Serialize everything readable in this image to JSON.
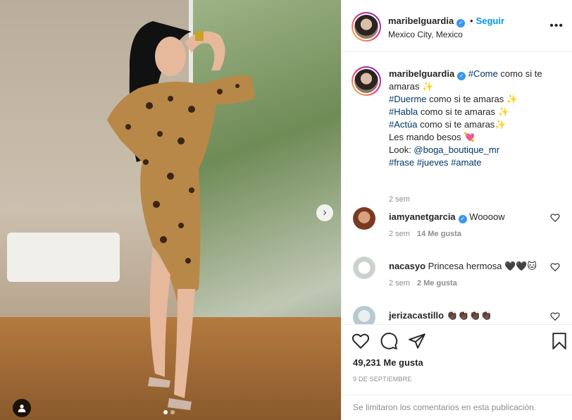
{
  "post": {
    "username": "maribelguardia",
    "verified_badge": "✓",
    "follow_dot": "•",
    "follow_label": "Seguir",
    "location": "Mexico City, Mexico",
    "more_label": "•••"
  },
  "caption": {
    "username": "maribelguardia",
    "line1_tag": "#Come",
    "line1_text": " como si te amaras ✨",
    "line2_tag": "#Duerme",
    "line2_text": " como si te amaras ✨",
    "line3_tag": "#Habla",
    "line3_text": " como si te amaras ✨",
    "line4_tag": "#Actúa",
    "line4_text": " como si te amaras✨",
    "line5": "Les mando besos 💘",
    "look_prefix": "Look: ",
    "look_handle": "@boga_boutique_mr",
    "tags": "#frase #jueves #amate",
    "time": "2 sem"
  },
  "comments": [
    {
      "username": "iamyanetgarcia",
      "verified": true,
      "text": "Woooow",
      "time": "2 sem",
      "likes": "14 Me gusta",
      "avatar_color": "#7a3a22"
    },
    {
      "username": "nacasyo",
      "verified": false,
      "text": "Princesa hermosa 🖤🖤🐱",
      "time": "2 sem",
      "likes": "2 Me gusta",
      "avatar_color": "#cfd8d0"
    },
    {
      "username": "jerizacastillo",
      "verified": false,
      "text": "👏🏿👏🏿👏🏿👏🏿",
      "time": "",
      "likes": "",
      "avatar_color": "#c8d6dc"
    }
  ],
  "actions": {
    "like_icon": "heart-icon",
    "comment_icon": "comment-icon",
    "share_icon": "share-icon",
    "save_icon": "bookmark-icon",
    "likes": "49,231 Me gusta",
    "date": "9 DE SEPTIEMBRE"
  },
  "footer": {
    "message": "Se limitaron los comentarios en esta publicación."
  },
  "carousel": {
    "next_label": "›",
    "slides": 2,
    "active_slide": 1
  },
  "colors": {
    "link_blue": "#0095f6",
    "hashtag": "#00376b",
    "muted": "#8e8e8e",
    "verified": "#3897f0"
  }
}
